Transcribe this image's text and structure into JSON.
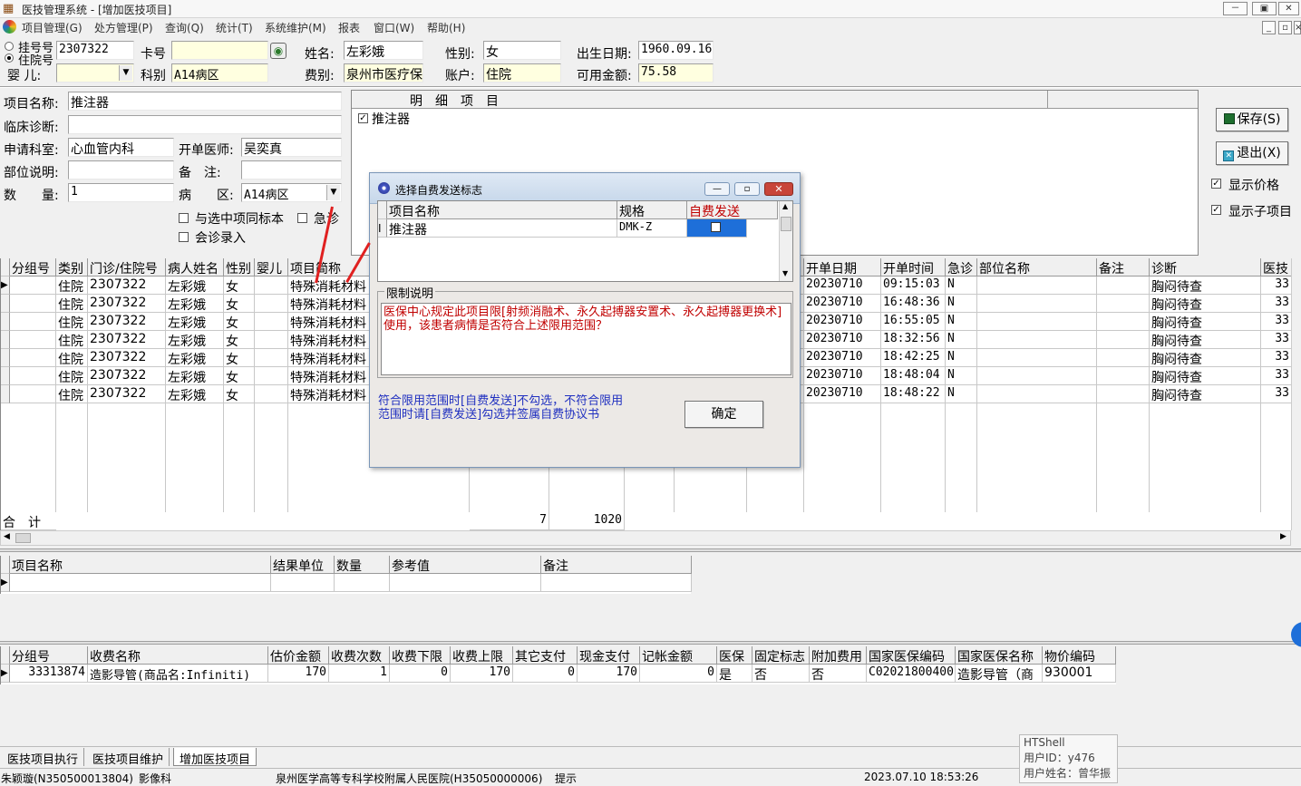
{
  "window": {
    "title": "医技管理系统 - [增加医技项目]",
    "controls": [
      "－",
      "▣",
      "✕"
    ],
    "mdi_controls": [
      "_",
      "▫",
      "×"
    ]
  },
  "menu": [
    "项目管理(G)",
    "处方管理(P)",
    "查询(Q)",
    "统计(T)",
    "系统维护(M)",
    "报表",
    "窗口(W)",
    "帮助(H)"
  ],
  "patient": {
    "radio_reg_label": "挂号号",
    "radio_hosp_label": "住院号",
    "id_value": "2307322",
    "card_label": "卡号",
    "card_value": "",
    "name_label": "姓名:",
    "name_value": "左彩娥",
    "gender_label": "性别:",
    "gender_value": "女",
    "dob_label": "出生日期:",
    "dob_value": "1960.09.16",
    "baby_label": "婴 儿:",
    "baby_value": "",
    "dept_label": "科别",
    "dept_value": "A14病区",
    "fee_label": "费别:",
    "fee_value": "泉州市医疗保",
    "account_label": "账户:",
    "account_value": "住院",
    "balance_label": "可用金额:",
    "balance_value": "75.58"
  },
  "form": {
    "item_name_label": "项目名称:",
    "item_name_value": "推注器",
    "diagnosis_label": "临床诊断:",
    "diagnosis_value": "",
    "apply_dept_label": "申请科室:",
    "apply_dept_value": "心血管内科",
    "doctor_label": "开单医师:",
    "doctor_value": "吴奕真",
    "site_label": "部位说明:",
    "site_value": "",
    "remark_label": "备　注:",
    "remark_value": "",
    "qty_label": "数　　量:",
    "qty_value": "1",
    "ward_label": "病　　区:",
    "ward_value": "A14病区",
    "same_specimen_label": "与选中项同标本",
    "emergency_label": "急诊",
    "consult_label": "会诊录入"
  },
  "detail_panel": {
    "header": "明　细　项　目",
    "items": [
      {
        "label": "推注器",
        "checked": true
      }
    ]
  },
  "right_buttons": {
    "save": "保存(S)",
    "exit": "退出(X)",
    "show_price": "显示价格",
    "show_subitems": "显示子项目"
  },
  "main_grid": {
    "columns": [
      "分组号",
      "类别",
      "门诊/住院号",
      "病人姓名",
      "性别",
      "婴儿",
      "项目简称",
      "开单日期",
      "开单时间",
      "急诊",
      "部位名称",
      "备注",
      "诊断",
      "医技"
    ],
    "rows": [
      {
        "type": "住院",
        "id": "2307322",
        "name": "左彩娥",
        "gender": "女",
        "item": "特殊消耗材料",
        "date": "20230710",
        "time": "09:15:03",
        "emerg": "N",
        "diag": "胸闷待查",
        "tech": "33"
      },
      {
        "type": "住院",
        "id": "2307322",
        "name": "左彩娥",
        "gender": "女",
        "item": "特殊消耗材料",
        "date": "20230710",
        "time": "16:48:36",
        "emerg": "N",
        "diag": "胸闷待查",
        "tech": "33"
      },
      {
        "type": "住院",
        "id": "2307322",
        "name": "左彩娥",
        "gender": "女",
        "item": "特殊消耗材料",
        "date": "20230710",
        "time": "16:55:05",
        "emerg": "N",
        "diag": "胸闷待查",
        "tech": "33"
      },
      {
        "type": "住院",
        "id": "2307322",
        "name": "左彩娥",
        "gender": "女",
        "item": "特殊消耗材料",
        "date": "20230710",
        "time": "18:32:56",
        "emerg": "N",
        "diag": "胸闷待查",
        "tech": "33"
      },
      {
        "type": "住院",
        "id": "2307322",
        "name": "左彩娥",
        "gender": "女",
        "item": "特殊消耗材料",
        "date": "20230710",
        "time": "18:42:25",
        "emerg": "N",
        "diag": "胸闷待查",
        "tech": "33"
      },
      {
        "type": "住院",
        "id": "2307322",
        "name": "左彩娥",
        "gender": "女",
        "item": "特殊消耗材料",
        "date": "20230710",
        "time": "18:48:04",
        "emerg": "N",
        "diag": "胸闷待查",
        "tech": "33"
      },
      {
        "type": "住院",
        "id": "2307322",
        "name": "左彩娥",
        "gender": "女",
        "item": "特殊消耗材料",
        "date": "20230710",
        "time": "18:48:22",
        "emerg": "N",
        "diag": "胸闷待查",
        "tech": "33"
      }
    ],
    "total_label": "合　计",
    "total_count": "7",
    "total_amount": "1020"
  },
  "result_grid": {
    "columns": [
      "项目名称",
      "结果单位",
      "数量",
      "参考值",
      "备注"
    ]
  },
  "fee_grid": {
    "columns": [
      "分组号",
      "收费名称",
      "估价金额",
      "收费次数",
      "收费下限",
      "收费上限",
      "其它支付",
      "现金支付",
      "记帐金额",
      "医保",
      "固定标志",
      "附加费用",
      "国家医保编码",
      "国家医保名称",
      "物价编码"
    ],
    "rows": [
      [
        "33313874",
        "造影导管(商品名:Infiniti)",
        "170",
        "1",
        "0",
        "170",
        "0",
        "170",
        "0",
        "是",
        "否",
        "否",
        "C02021800400",
        "造影导管（商",
        "930001"
      ]
    ]
  },
  "dialog": {
    "title": "选择自费发送标志",
    "columns": [
      "项目名称",
      "规格",
      "自费发送"
    ],
    "rows": [
      {
        "name": "推注器",
        "spec": "DMK-Z",
        "self_pay": false
      }
    ],
    "limit_title": "限制说明",
    "limit_text": "医保中心规定此项目限[射频消融术、永久起搏器安置术、永久起搏器更换术]使用，该患者病情是否符合上述限用范围？",
    "hint_text": "符合限用范围时[自费发送]不勾选，不符合限用范围时请[自费发送]勾选并签属自费协议书",
    "ok": "确定"
  },
  "tabs": [
    "医技项目执行",
    "医技项目维护",
    "增加医技项目"
  ],
  "status": {
    "user": "朱颖璇(N350500013804)",
    "dept": "影像科",
    "hospital": "泉州医学高等专科学校附属人民医院(H35050000006)",
    "hint": "提示",
    "datetime": "2023.07.10 18:53:26"
  },
  "htshell": {
    "title": "HTShell",
    "userid": "用户ID：y476",
    "username": "用户姓名：曾华振"
  },
  "colors": {
    "accent_red": "#c00000",
    "dialog_text_blue": "#2030c0",
    "selection_blue": "#1e6fd9"
  }
}
